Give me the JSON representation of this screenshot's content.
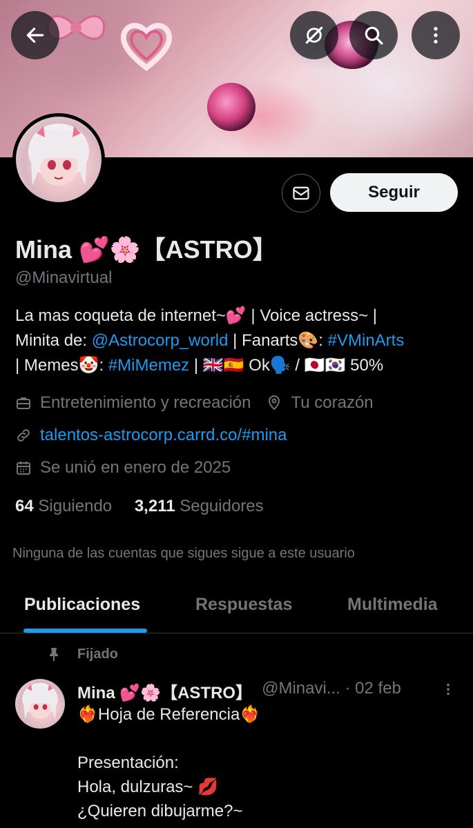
{
  "header": {
    "back_icon": "arrow-left-icon",
    "grok_icon": "grok-icon",
    "search_icon": "search-icon",
    "more_icon": "more-vertical-icon"
  },
  "profile": {
    "display_name": "Mina 💕🌸【ASTRO】",
    "handle": "@Minavirtual",
    "follow_label": "Seguir",
    "message_icon": "mail-icon",
    "bio": {
      "line1_a": "La mas coqueta de internet~💕 | Voice actress~ |",
      "line2_a": "Minita de: ",
      "line2_link": "@Astrocorp_world",
      "line2_b": " | Fanarts🎨: ",
      "line2_tag": "#VMinArts",
      "line3_a": "| Memes🤡: ",
      "line3_tag": "#MiMemez",
      "line3_b": " | 🇬🇧🇪🇸 Ok🗣️ / 🇯🇵🇰🇷 50%"
    },
    "category": "Entretenimiento y recreación",
    "location": "Tu corazón",
    "website": "talentos-astrocorp.carrd.co/#mina",
    "joined": "Se unió en enero de 2025",
    "following_count": "64",
    "following_label": "Siguiendo",
    "followers_count": "3,211",
    "followers_label": "Seguidores",
    "mutuals_note": "Ninguna de las cuentas que sigues sigue a este usuario"
  },
  "tabs": [
    {
      "label": "Publicaciones",
      "active": true
    },
    {
      "label": "Respuestas",
      "active": false
    },
    {
      "label": "Multimedia",
      "active": false
    }
  ],
  "post": {
    "pinned_label": "Fijado",
    "author_name": "Mina 💕🌸【ASTRO】",
    "author_handle": "@Minavi... · 02 feb",
    "text": "❤️‍🔥Hoja de Referencia❤️‍🔥\n\nPresentación:\nHola, dulzuras~ 💋\n¿Quieren dibujarme?~"
  },
  "colors": {
    "accent": "#1d9bf0",
    "muted": "#71767b",
    "background": "#000000"
  }
}
